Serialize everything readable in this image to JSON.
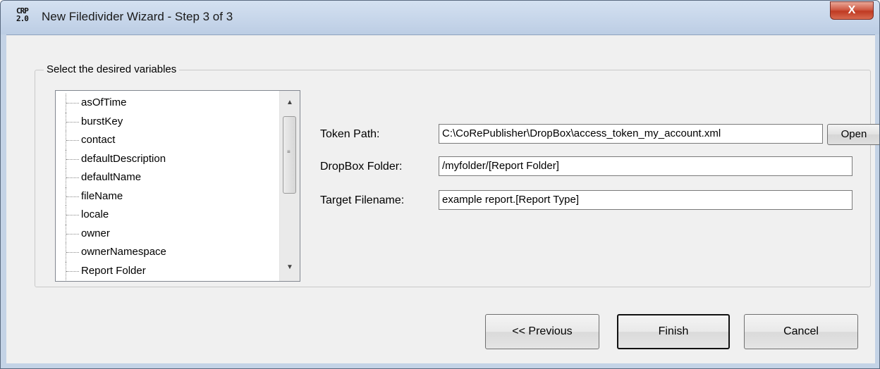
{
  "window": {
    "title": "New Filedivider Wizard - Step 3 of 3",
    "app_icon_line1": "CRP",
    "app_icon_line2": "2.0",
    "close_glyph": "X"
  },
  "group": {
    "legend": "Select the desired variables"
  },
  "variables": {
    "items": [
      "asOfTime",
      "burstKey",
      "contact",
      "defaultDescription",
      "defaultName",
      "fileName",
      "locale",
      "owner",
      "ownerNamespace",
      "Report Folder"
    ]
  },
  "form": {
    "token_path_label": "Token Path:",
    "token_path_value": "C:\\CoRePublisher\\DropBox\\access_token_my_account.xml",
    "open_label": "Open",
    "dropbox_folder_label": "DropBox Folder:",
    "dropbox_folder_value": "/myfolder/[Report Folder]",
    "target_filename_label": "Target Filename:",
    "target_filename_value": "example report.[Report Type]"
  },
  "buttons": {
    "previous": "<< Previous",
    "finish": "Finish",
    "cancel": "Cancel"
  },
  "icons": {
    "close": "close-icon",
    "scroll_up": "scroll-up-arrow-icon",
    "scroll_down": "scroll-down-arrow-icon"
  },
  "colors": {
    "titlebar": "#c4d3e6",
    "close_button": "#c94b34",
    "dialog_background": "#f0f0f0"
  }
}
